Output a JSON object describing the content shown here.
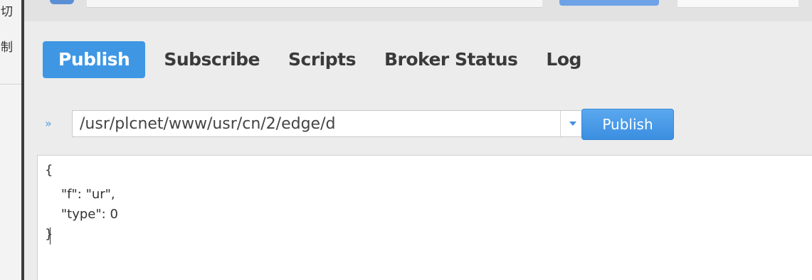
{
  "left_panel": {
    "chars": [
      "切",
      "制"
    ]
  },
  "tabs": [
    {
      "label": "Publish",
      "active": true
    },
    {
      "label": "Subscribe",
      "active": false
    },
    {
      "label": "Scripts",
      "active": false
    },
    {
      "label": "Broker Status",
      "active": false
    },
    {
      "label": "Log",
      "active": false
    }
  ],
  "publish": {
    "expand_icon": "»",
    "topic_value": "/usr/plcnet/www/usr/cn/2/edge/d",
    "dropdown_icon": "chevron-down-icon",
    "button_label": "Publish"
  },
  "payload": {
    "lines": [
      "{",
      "    \"f\": \"ur\",",
      "    \"type\": 0",
      "}"
    ]
  },
  "colors": {
    "accent": "#3f97e4",
    "panel_bg": "#ececec"
  }
}
